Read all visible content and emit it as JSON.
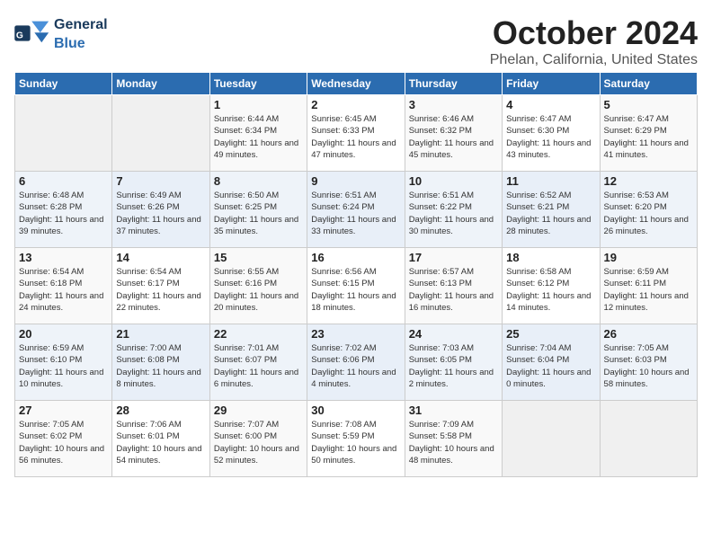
{
  "app": {
    "logo_general": "General",
    "logo_blue": "Blue",
    "month_title": "October 2024",
    "location": "Phelan, California, United States"
  },
  "calendar": {
    "days_of_week": [
      "Sunday",
      "Monday",
      "Tuesday",
      "Wednesday",
      "Thursday",
      "Friday",
      "Saturday"
    ],
    "weeks": [
      [
        {
          "day": "",
          "detail": ""
        },
        {
          "day": "",
          "detail": ""
        },
        {
          "day": "1",
          "detail": "Sunrise: 6:44 AM\nSunset: 6:34 PM\nDaylight: 11 hours and 49 minutes."
        },
        {
          "day": "2",
          "detail": "Sunrise: 6:45 AM\nSunset: 6:33 PM\nDaylight: 11 hours and 47 minutes."
        },
        {
          "day": "3",
          "detail": "Sunrise: 6:46 AM\nSunset: 6:32 PM\nDaylight: 11 hours and 45 minutes."
        },
        {
          "day": "4",
          "detail": "Sunrise: 6:47 AM\nSunset: 6:30 PM\nDaylight: 11 hours and 43 minutes."
        },
        {
          "day": "5",
          "detail": "Sunrise: 6:47 AM\nSunset: 6:29 PM\nDaylight: 11 hours and 41 minutes."
        }
      ],
      [
        {
          "day": "6",
          "detail": "Sunrise: 6:48 AM\nSunset: 6:28 PM\nDaylight: 11 hours and 39 minutes."
        },
        {
          "day": "7",
          "detail": "Sunrise: 6:49 AM\nSunset: 6:26 PM\nDaylight: 11 hours and 37 minutes."
        },
        {
          "day": "8",
          "detail": "Sunrise: 6:50 AM\nSunset: 6:25 PM\nDaylight: 11 hours and 35 minutes."
        },
        {
          "day": "9",
          "detail": "Sunrise: 6:51 AM\nSunset: 6:24 PM\nDaylight: 11 hours and 33 minutes."
        },
        {
          "day": "10",
          "detail": "Sunrise: 6:51 AM\nSunset: 6:22 PM\nDaylight: 11 hours and 30 minutes."
        },
        {
          "day": "11",
          "detail": "Sunrise: 6:52 AM\nSunset: 6:21 PM\nDaylight: 11 hours and 28 minutes."
        },
        {
          "day": "12",
          "detail": "Sunrise: 6:53 AM\nSunset: 6:20 PM\nDaylight: 11 hours and 26 minutes."
        }
      ],
      [
        {
          "day": "13",
          "detail": "Sunrise: 6:54 AM\nSunset: 6:18 PM\nDaylight: 11 hours and 24 minutes."
        },
        {
          "day": "14",
          "detail": "Sunrise: 6:54 AM\nSunset: 6:17 PM\nDaylight: 11 hours and 22 minutes."
        },
        {
          "day": "15",
          "detail": "Sunrise: 6:55 AM\nSunset: 6:16 PM\nDaylight: 11 hours and 20 minutes."
        },
        {
          "day": "16",
          "detail": "Sunrise: 6:56 AM\nSunset: 6:15 PM\nDaylight: 11 hours and 18 minutes."
        },
        {
          "day": "17",
          "detail": "Sunrise: 6:57 AM\nSunset: 6:13 PM\nDaylight: 11 hours and 16 minutes."
        },
        {
          "day": "18",
          "detail": "Sunrise: 6:58 AM\nSunset: 6:12 PM\nDaylight: 11 hours and 14 minutes."
        },
        {
          "day": "19",
          "detail": "Sunrise: 6:59 AM\nSunset: 6:11 PM\nDaylight: 11 hours and 12 minutes."
        }
      ],
      [
        {
          "day": "20",
          "detail": "Sunrise: 6:59 AM\nSunset: 6:10 PM\nDaylight: 11 hours and 10 minutes."
        },
        {
          "day": "21",
          "detail": "Sunrise: 7:00 AM\nSunset: 6:08 PM\nDaylight: 11 hours and 8 minutes."
        },
        {
          "day": "22",
          "detail": "Sunrise: 7:01 AM\nSunset: 6:07 PM\nDaylight: 11 hours and 6 minutes."
        },
        {
          "day": "23",
          "detail": "Sunrise: 7:02 AM\nSunset: 6:06 PM\nDaylight: 11 hours and 4 minutes."
        },
        {
          "day": "24",
          "detail": "Sunrise: 7:03 AM\nSunset: 6:05 PM\nDaylight: 11 hours and 2 minutes."
        },
        {
          "day": "25",
          "detail": "Sunrise: 7:04 AM\nSunset: 6:04 PM\nDaylight: 11 hours and 0 minutes."
        },
        {
          "day": "26",
          "detail": "Sunrise: 7:05 AM\nSunset: 6:03 PM\nDaylight: 10 hours and 58 minutes."
        }
      ],
      [
        {
          "day": "27",
          "detail": "Sunrise: 7:05 AM\nSunset: 6:02 PM\nDaylight: 10 hours and 56 minutes."
        },
        {
          "day": "28",
          "detail": "Sunrise: 7:06 AM\nSunset: 6:01 PM\nDaylight: 10 hours and 54 minutes."
        },
        {
          "day": "29",
          "detail": "Sunrise: 7:07 AM\nSunset: 6:00 PM\nDaylight: 10 hours and 52 minutes."
        },
        {
          "day": "30",
          "detail": "Sunrise: 7:08 AM\nSunset: 5:59 PM\nDaylight: 10 hours and 50 minutes."
        },
        {
          "day": "31",
          "detail": "Sunrise: 7:09 AM\nSunset: 5:58 PM\nDaylight: 10 hours and 48 minutes."
        },
        {
          "day": "",
          "detail": ""
        },
        {
          "day": "",
          "detail": ""
        }
      ]
    ]
  }
}
